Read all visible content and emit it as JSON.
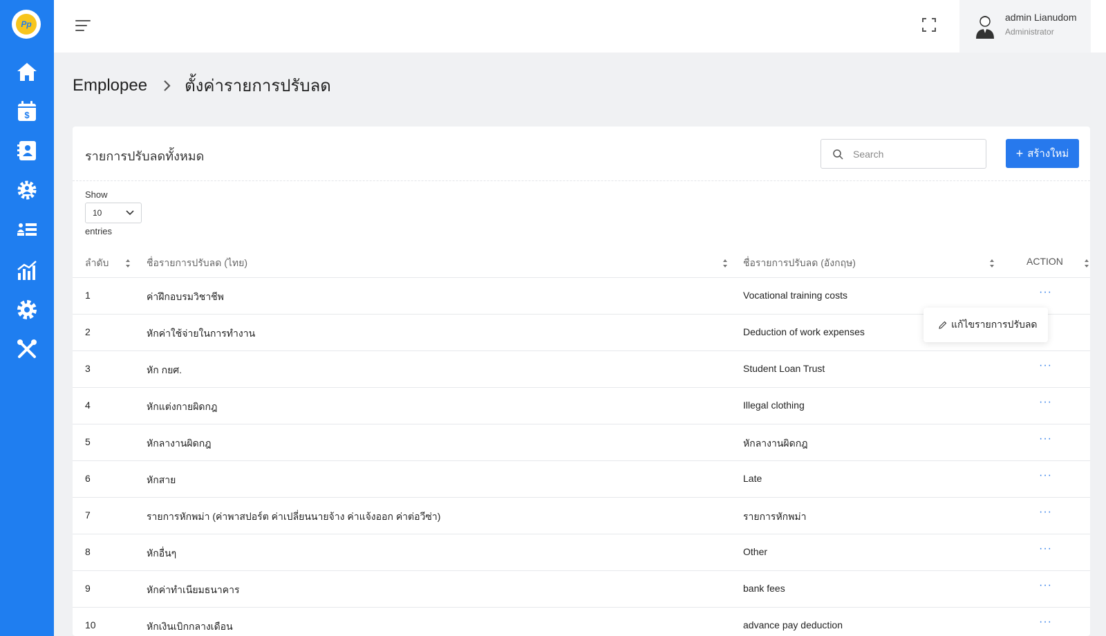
{
  "header": {
    "user_name": "admin Lianudom",
    "user_role": "Administrator"
  },
  "breadcrumb": {
    "parent": "Emplopee",
    "current": "ตั้งค่ารายการปรับลด"
  },
  "card": {
    "title": "รายการปรับลดทั้งหมด",
    "search_placeholder": "Search",
    "create_label": "สร้างใหม่",
    "create_icon": "+"
  },
  "entries": {
    "show_label": "Show",
    "value": "10",
    "entries_label": "entries"
  },
  "table": {
    "columns": {
      "no": "ลำดับ",
      "name_th": "ชื่อรายการปรับลด (ไทย)",
      "name_en": "ชื่อรายการปรับลด (อังกฤษ)",
      "action": "ACTION"
    },
    "action_icon": "···",
    "rows": [
      {
        "no": "1",
        "name_th": "ค่าฝึกอบรมวิชาชีพ",
        "name_en": "Vocational training costs"
      },
      {
        "no": "2",
        "name_th": "หักค่าใช้จ่ายในการทำงาน",
        "name_en": "Deduction of work expenses"
      },
      {
        "no": "3",
        "name_th": "หัก กยศ.",
        "name_en": "Student Loan Trust"
      },
      {
        "no": "4",
        "name_th": "หักแต่งกายผิดกฎ",
        "name_en": "Illegal clothing"
      },
      {
        "no": "5",
        "name_th": "หักลางานผิดกฎ",
        "name_en": "หักลางานผิดกฎ"
      },
      {
        "no": "6",
        "name_th": "หักสาย",
        "name_en": "Late"
      },
      {
        "no": "7",
        "name_th": "รายการหักพม่า (ค่าพาสปอร์ต ค่าเปลี่ยนนายจ้าง ค่าแจ้งออก ค่าต่อวีซ่า)",
        "name_en": "รายการหักพม่า"
      },
      {
        "no": "8",
        "name_th": "หักอื่นๆ",
        "name_en": "Other"
      },
      {
        "no": "9",
        "name_th": "หักค่าทำเนียมธนาคาร",
        "name_en": "bank fees"
      },
      {
        "no": "10",
        "name_th": "หักเงินเบิกกลางเดือน",
        "name_en": "advance pay deduction"
      }
    ]
  },
  "dropdown": {
    "edit_label": "แก้ไขรายการปรับลด"
  },
  "colors": {
    "sidebar": "#1f7ef0",
    "primary": "#2779ed",
    "background": "#f0f1f3"
  },
  "icons": {
    "sidebar": [
      "home-icon",
      "payroll-calendar-icon",
      "contact-book-icon",
      "team-gear-icon",
      "list-icon",
      "chart-icon",
      "settings-icon",
      "tools-icon"
    ],
    "topbar": [
      "menu-icon",
      "fullscreen-icon",
      "user-avatar-icon"
    ]
  }
}
